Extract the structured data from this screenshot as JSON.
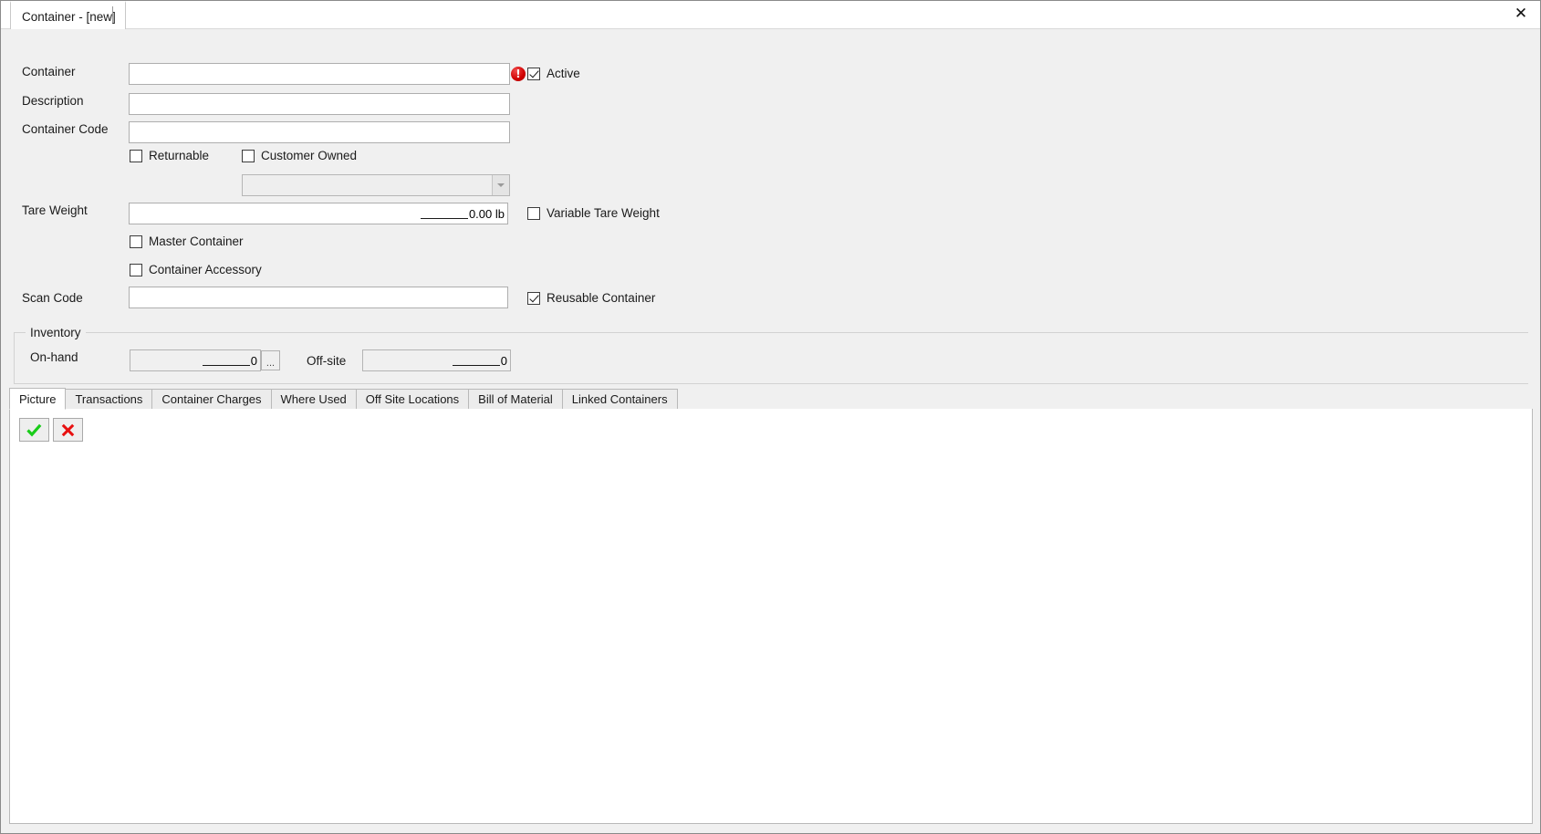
{
  "window": {
    "document_tab_label": "Container - [new]",
    "close_label": "✕"
  },
  "form": {
    "fields": {
      "container_label": "Container",
      "container_value": "",
      "container_placeholder": "",
      "description_label": "Description",
      "description_value": "",
      "container_code_label": "Container Code",
      "container_code_value": "",
      "tare_weight_label": "Tare Weight",
      "tare_weight_value": "0.00 lb",
      "scan_code_label": "Scan Code",
      "scan_code_value": "",
      "owner_combo_value": ""
    },
    "checkboxes": {
      "active_label": "Active",
      "active_checked": true,
      "returnable_label": "Returnable",
      "returnable_checked": false,
      "customer_owned_label": "Customer Owned",
      "customer_owned_checked": false,
      "variable_tare_weight_label": "Variable Tare Weight",
      "variable_tare_weight_checked": false,
      "master_container_label": "Master Container",
      "master_container_checked": false,
      "container_accessory_label": "Container Accessory",
      "container_accessory_checked": false,
      "reusable_container_label": "Reusable Container",
      "reusable_container_checked": true
    },
    "validation": {
      "container_error_glyph": "!",
      "error_color": "#d00000"
    },
    "inventory": {
      "group_title": "Inventory",
      "on_hand_label": "On-hand",
      "on_hand_value": "0",
      "on_hand_browse_label": "...",
      "off_site_label": "Off-site",
      "off_site_value": "0"
    }
  },
  "tabs": {
    "active_index": 0,
    "items": [
      {
        "label": "Picture"
      },
      {
        "label": "Transactions"
      },
      {
        "label": "Container Charges"
      },
      {
        "label": "Where Used"
      },
      {
        "label": "Off Site Locations"
      },
      {
        "label": "Bill of Material"
      },
      {
        "label": "Linked Containers"
      }
    ]
  },
  "picture_toolbar": {
    "accept_icon": "check-icon",
    "accept_color": "#19cc19",
    "cancel_icon": "cross-icon",
    "cancel_color": "#e81010"
  }
}
